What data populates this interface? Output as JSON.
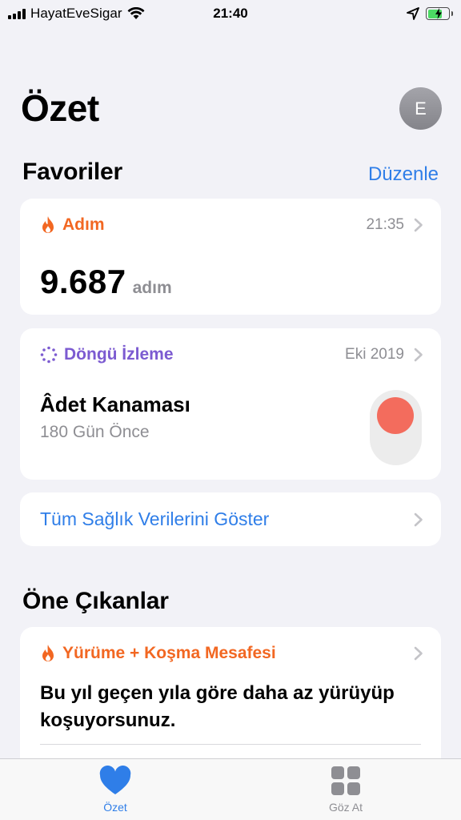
{
  "status_bar": {
    "carrier": "HayatEveSigar",
    "time": "21:40"
  },
  "header": {
    "title": "Özet",
    "avatar_initial": "E"
  },
  "favorites": {
    "title": "Favoriler",
    "edit_label": "Düzenle",
    "steps_card": {
      "category": "Adım",
      "time": "21:35",
      "value": "9.687",
      "unit": "adım",
      "color": "#f26722"
    },
    "cycle_card": {
      "category": "Döngü İzleme",
      "date": "Eki 2019",
      "title": "Âdet Kanaması",
      "subtitle": "180 Gün Önce",
      "color": "#7c5bd1",
      "dot_color": "#f36c5d"
    },
    "show_all_label": "Tüm Sağlık Verilerini Göster"
  },
  "highlights": {
    "title": "Öne Çıkanlar",
    "card": {
      "category": "Yürüme + Koşma Mesafesi",
      "text": "Bu yıl geçen yıla göre daha az yürüyüp koşuyorsunuz.",
      "color": "#f26722"
    }
  },
  "tab_bar": {
    "tabs": [
      {
        "label": "Özet",
        "icon": "heart-icon",
        "active": true,
        "color": "#2f7ee8"
      },
      {
        "label": "Göz At",
        "icon": "grid-icon",
        "active": false,
        "color": "#8e8e93"
      }
    ]
  }
}
